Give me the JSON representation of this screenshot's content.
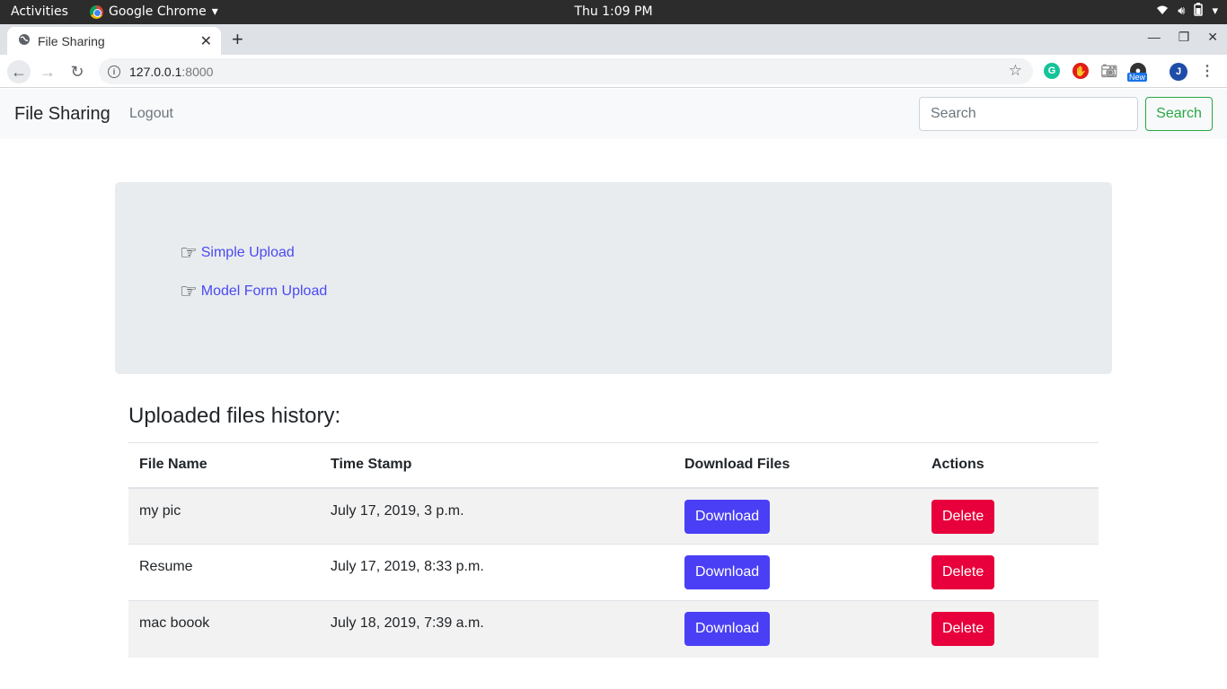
{
  "os": {
    "activities": "Activities",
    "app_name": "Google Chrome",
    "clock": "Thu  1:09 PM"
  },
  "browser": {
    "tab_title": "File Sharing",
    "url_host": "127.0.0.1",
    "url_port": ":8000",
    "new_badge": "New",
    "profile_initial": "J"
  },
  "navbar": {
    "brand": "File Sharing",
    "logout": "Logout",
    "search_placeholder": "Search",
    "search_button": "Search"
  },
  "uploads": {
    "simple": "Simple Upload",
    "model_form": "Model Form Upload"
  },
  "history": {
    "title": "Uploaded files history:",
    "columns": [
      "File Name",
      "Time Stamp",
      "Download Files",
      "Actions"
    ],
    "rows": [
      {
        "name": "my pic",
        "timestamp": "July 17, 2019, 3 p.m.",
        "download": "Download",
        "delete": "Delete"
      },
      {
        "name": "Resume",
        "timestamp": "July 17, 2019, 8:33 p.m.",
        "download": "Download",
        "delete": "Delete"
      },
      {
        "name": "mac boook",
        "timestamp": "July 18, 2019, 7:39 a.m.",
        "download": "Download",
        "delete": "Delete"
      }
    ]
  },
  "colors": {
    "download_button": "#4a3ff5",
    "delete_button": "#e8003c",
    "link": "#4a4aef",
    "search_outline": "#28a745"
  }
}
